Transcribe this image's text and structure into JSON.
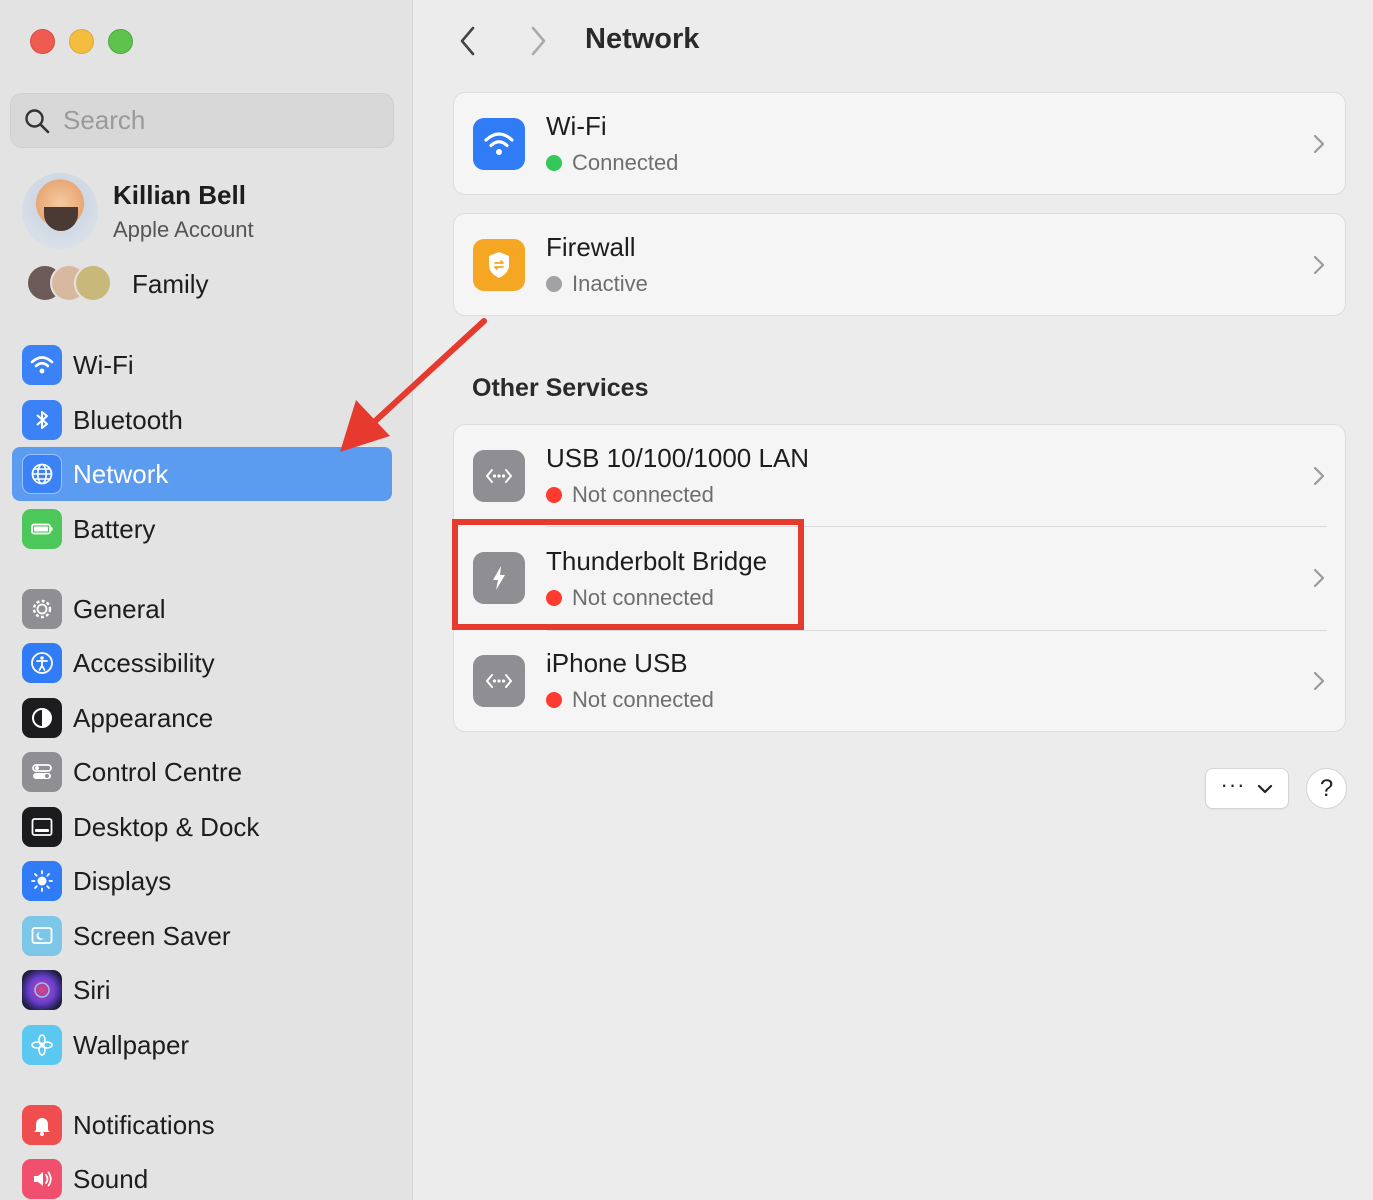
{
  "window": {
    "controls": [
      "close",
      "minimize",
      "maximize"
    ]
  },
  "sidebar": {
    "search": {
      "placeholder": "Search",
      "value": ""
    },
    "account": {
      "name": "Killian Bell",
      "subtitle": "Apple Account"
    },
    "family": {
      "label": "Family"
    },
    "items": [
      {
        "label": "Wi-Fi",
        "icon": "wifi-icon",
        "color": "#3b82f6",
        "active": false
      },
      {
        "label": "Bluetooth",
        "icon": "bluetooth-icon",
        "color": "#3b82f6",
        "active": false
      },
      {
        "label": "Network",
        "icon": "globe-icon",
        "color": "#3b82f6",
        "active": true
      },
      {
        "label": "Battery",
        "icon": "battery-icon",
        "color": "#4cc75a",
        "active": false
      },
      {
        "label": "General",
        "icon": "gear-icon",
        "color": "#8e8e93",
        "active": false
      },
      {
        "label": "Accessibility",
        "icon": "accessibility-icon",
        "color": "#2f7cf6",
        "active": false
      },
      {
        "label": "Appearance",
        "icon": "appearance-icon",
        "color": "#1c1c1e",
        "active": false
      },
      {
        "label": "Control Centre",
        "icon": "control-centre-icon",
        "color": "#8e8e93",
        "active": false
      },
      {
        "label": "Desktop & Dock",
        "icon": "desktop-dock-icon",
        "color": "#1c1c1e",
        "active": false
      },
      {
        "label": "Displays",
        "icon": "displays-icon",
        "color": "#2f7cf6",
        "active": false
      },
      {
        "label": "Screen Saver",
        "icon": "screen-saver-icon",
        "color": "#7cc6e8",
        "active": false
      },
      {
        "label": "Siri",
        "icon": "siri-icon",
        "color": "#2b2b5e",
        "active": false
      },
      {
        "label": "Wallpaper",
        "icon": "wallpaper-icon",
        "color": "#5ac8f0",
        "active": false
      },
      {
        "label": "Notifications",
        "icon": "notifications-icon",
        "color": "#f04e4e",
        "active": false
      },
      {
        "label": "Sound",
        "icon": "sound-icon",
        "color": "#f0506e",
        "active": false
      }
    ]
  },
  "main": {
    "title": "Network",
    "top_services": [
      {
        "name": "Wi-Fi",
        "status": "Connected",
        "status_color": "#34c759",
        "icon": "wifi-icon",
        "icon_color": "#2f7cf6"
      },
      {
        "name": "Firewall",
        "status": "Inactive",
        "status_color": "#a1a1a6",
        "icon": "firewall-shield-icon",
        "icon_color": "#f5a623"
      }
    ],
    "other_services_heading": "Other Services",
    "other_services": [
      {
        "name": "USB 10/100/1000 LAN",
        "status": "Not connected",
        "status_color": "#ff3b30",
        "icon": "ethernet-icon",
        "icon_color": "#8e8e93"
      },
      {
        "name": "Thunderbolt Bridge",
        "status": "Not connected",
        "status_color": "#ff3b30",
        "icon": "thunderbolt-icon",
        "icon_color": "#8e8e93"
      },
      {
        "name": "iPhone USB",
        "status": "Not connected",
        "status_color": "#ff3b30",
        "icon": "ethernet-icon",
        "icon_color": "#8e8e93"
      }
    ],
    "more_button": "···",
    "help_button": "?"
  },
  "annotations": {
    "arrow_color": "#e53a2d",
    "highlight_color": "#e53a2d"
  }
}
